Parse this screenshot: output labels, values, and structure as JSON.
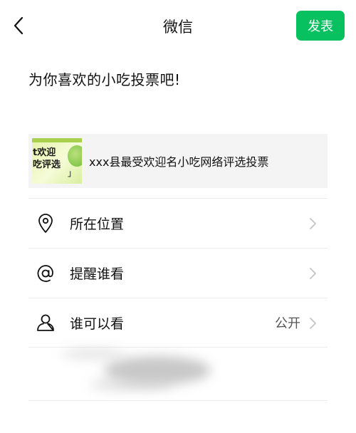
{
  "header": {
    "back_icon": "chevron-left-icon",
    "title": "微信",
    "publish_label": "发表",
    "accent_color": "#07c160"
  },
  "post": {
    "text": "为你喜欢的小吃投票吧!"
  },
  "link_card": {
    "thumbnail_text": "t欢迎\n吃评选",
    "thumbnail_bracket": "」",
    "title": "xxx县最受欢迎名小吃网络评选投票"
  },
  "menu": {
    "items": [
      {
        "icon": "location-pin-icon",
        "label": "所在位置",
        "value": ""
      },
      {
        "icon": "at-sign-icon",
        "label": "提醒谁看",
        "value": ""
      },
      {
        "icon": "person-icon",
        "label": "谁可以看",
        "value": "公开"
      }
    ]
  }
}
